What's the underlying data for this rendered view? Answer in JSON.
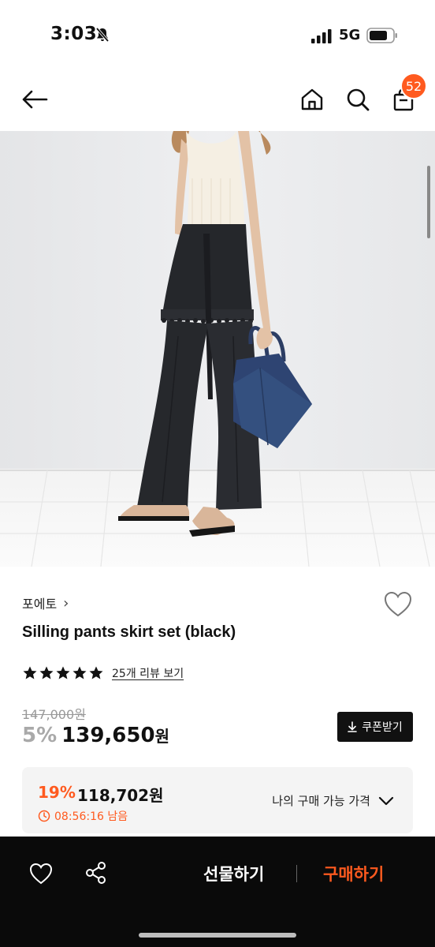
{
  "status_bar": {
    "time": "3:03",
    "network": "5G"
  },
  "nav": {
    "cart_count": "52"
  },
  "product": {
    "brand": "포에토",
    "brand_chevron": "›",
    "title": "Silling pants skirt set (black)",
    "rating_stars": 5,
    "review_link": "25개 리뷰 보기",
    "original_price": "147,000원",
    "discount": "5%",
    "sale_price": "139,650",
    "currency": "원",
    "coupon_button": "쿠폰받기",
    "member_discount": "19%",
    "member_price": "118,702원",
    "timer": "08:56:16 남음",
    "my_price_label": "나의 구매 가능 가격"
  },
  "bottom_bar": {
    "gift_label": "선물하기",
    "buy_label": "구매하기"
  },
  "colors": {
    "accent": "#ff5a1f",
    "dark": "#0a0a0a"
  }
}
